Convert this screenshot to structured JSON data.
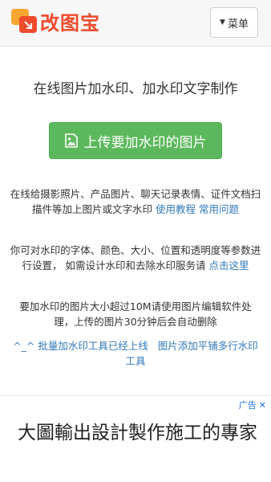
{
  "header": {
    "logo_text": "改图宝",
    "menu_label": "菜单",
    "brand_colors": {
      "logo_red": "#ef4b2d",
      "logo_orange": "#f8a630"
    }
  },
  "main": {
    "headline": "在线图片加水印、加水印文字制作",
    "upload_button": "上传要加水印的图片",
    "upload_button_color": "#5cb85c",
    "para1_text": "在线给摄影照片、产品图片、聊天记录表情、证件文档扫描件等加上图片或文字水印",
    "para1_link1": "使用教程",
    "para1_link2": "常用问题",
    "para2_text": "你可对水印的字体、颜色、大小、位置和透明度等参数进行设置， 如需设计水印和去除水印服务请",
    "para2_link": "点击这里",
    "para3_text": "要加水印的图片大小超过10M请使用图片编辑软件处理，上传的图片30分钟后会自动删除",
    "para4_link1": "^_^ 批量加水印工具已经上线",
    "para4_link2": "图片添加平铺多行水印工具",
    "link_color": "#337ab7"
  },
  "ad": {
    "label": "广告",
    "close": "✕",
    "text": "大圖輸出設計製作施工的專家"
  }
}
